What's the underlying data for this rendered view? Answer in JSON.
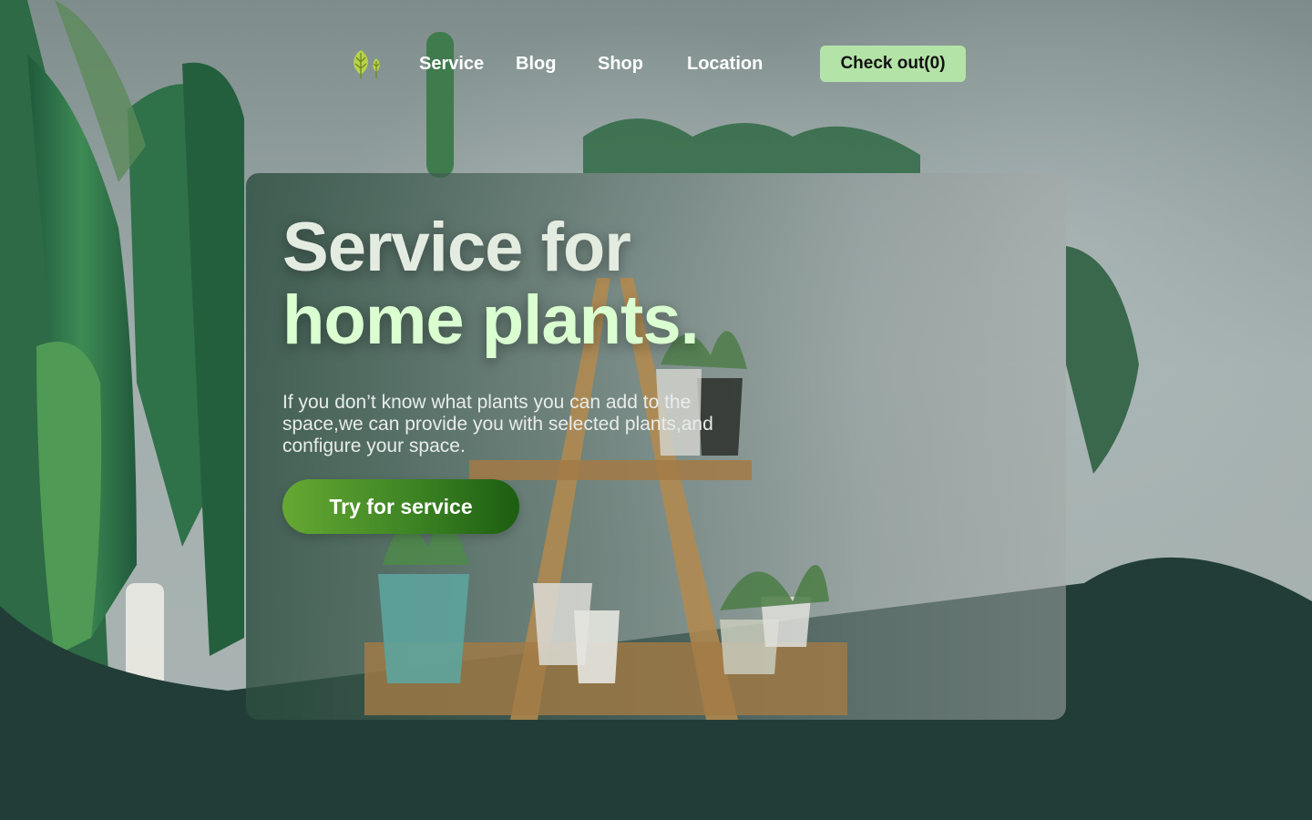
{
  "nav": {
    "links": [
      {
        "label": "Service"
      },
      {
        "label": "Blog"
      },
      {
        "label": "Shop"
      },
      {
        "label": "Location"
      }
    ],
    "checkout_label": "Check out(0)"
  },
  "hero": {
    "title_line1": "Service for",
    "title_line2": "home plants.",
    "description": "If you don’t know what plants you can add to the space,we can provide you with selected plants,and configure your space.",
    "cta_label": "Try for service"
  },
  "icons": {
    "logo": "leaf-tree-icon"
  },
  "colors": {
    "accent_green": "#b4e3a8",
    "dark_green": "#223d37",
    "cta_start": "#66a832",
    "cta_end": "#1c5d10"
  }
}
